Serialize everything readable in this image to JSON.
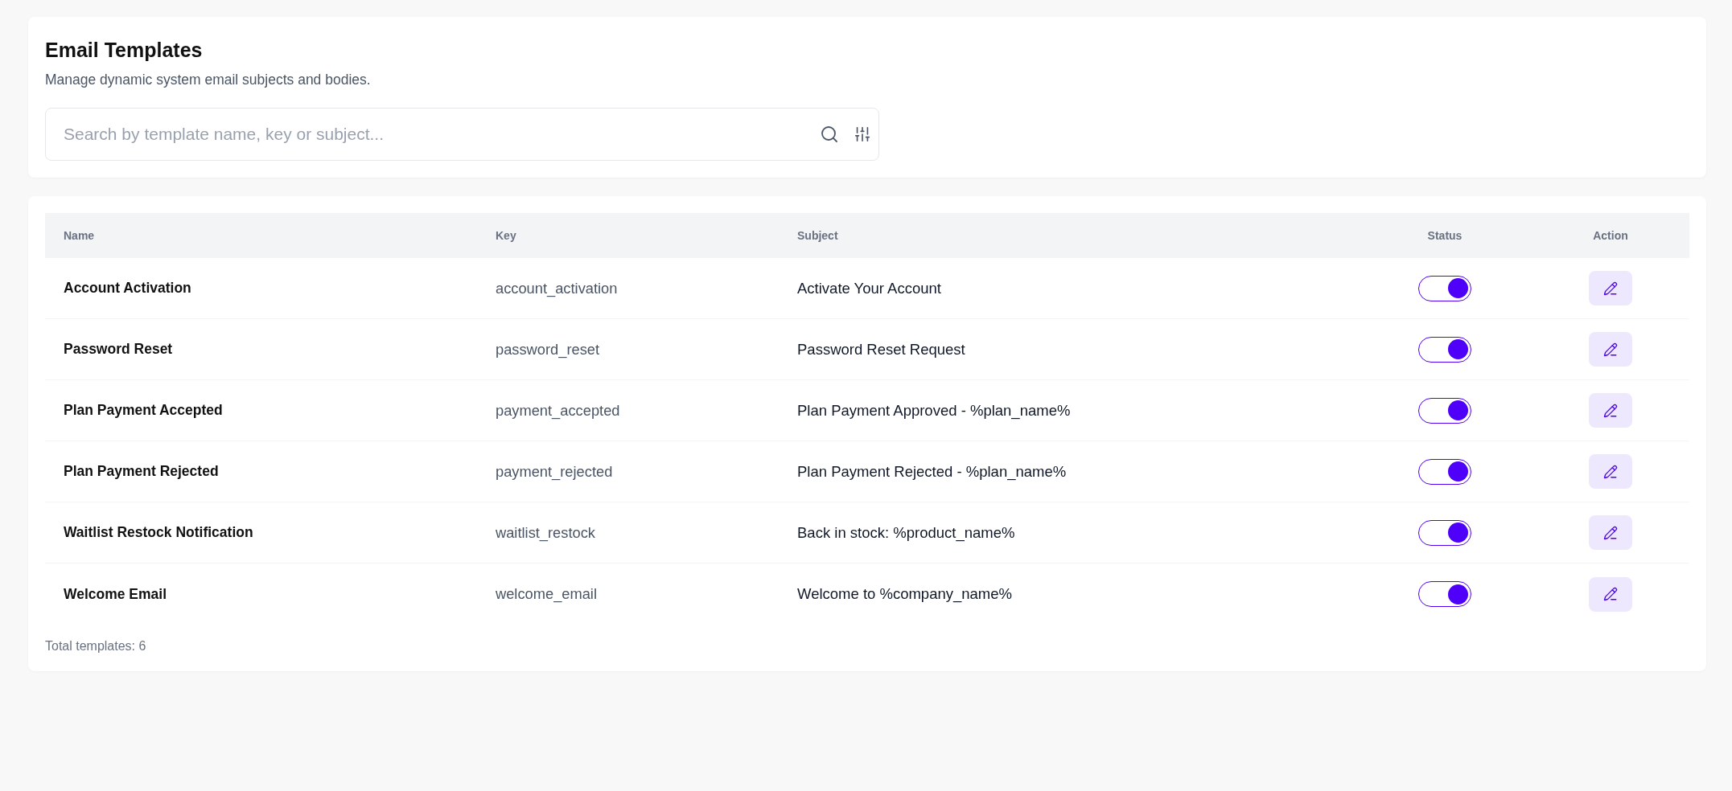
{
  "page": {
    "title": "Email Templates",
    "subtitle": "Manage dynamic system email subjects and bodies."
  },
  "search": {
    "placeholder": "Search by template name, key or subject..."
  },
  "table": {
    "columns": [
      "Name",
      "Key",
      "Subject",
      "Status",
      "Action"
    ],
    "rows": [
      {
        "name": "Account Activation",
        "key": "account_activation",
        "subject": "Activate Your Account",
        "enabled": true
      },
      {
        "name": "Password Reset",
        "key": "password_reset",
        "subject": "Password Reset Request",
        "enabled": true
      },
      {
        "name": "Plan Payment Accepted",
        "key": "payment_accepted",
        "subject": "Plan Payment Approved - %plan_name%",
        "enabled": true
      },
      {
        "name": "Plan Payment Rejected",
        "key": "payment_rejected",
        "subject": "Plan Payment Rejected - %plan_name%",
        "enabled": true
      },
      {
        "name": "Waitlist Restock Notification",
        "key": "waitlist_restock",
        "subject": "Back in stock: %product_name%",
        "enabled": true
      },
      {
        "name": "Welcome Email",
        "key": "welcome_email",
        "subject": "Welcome to %company_name%",
        "enabled": true
      }
    ]
  },
  "footer": {
    "total": "Total templates: 6"
  }
}
